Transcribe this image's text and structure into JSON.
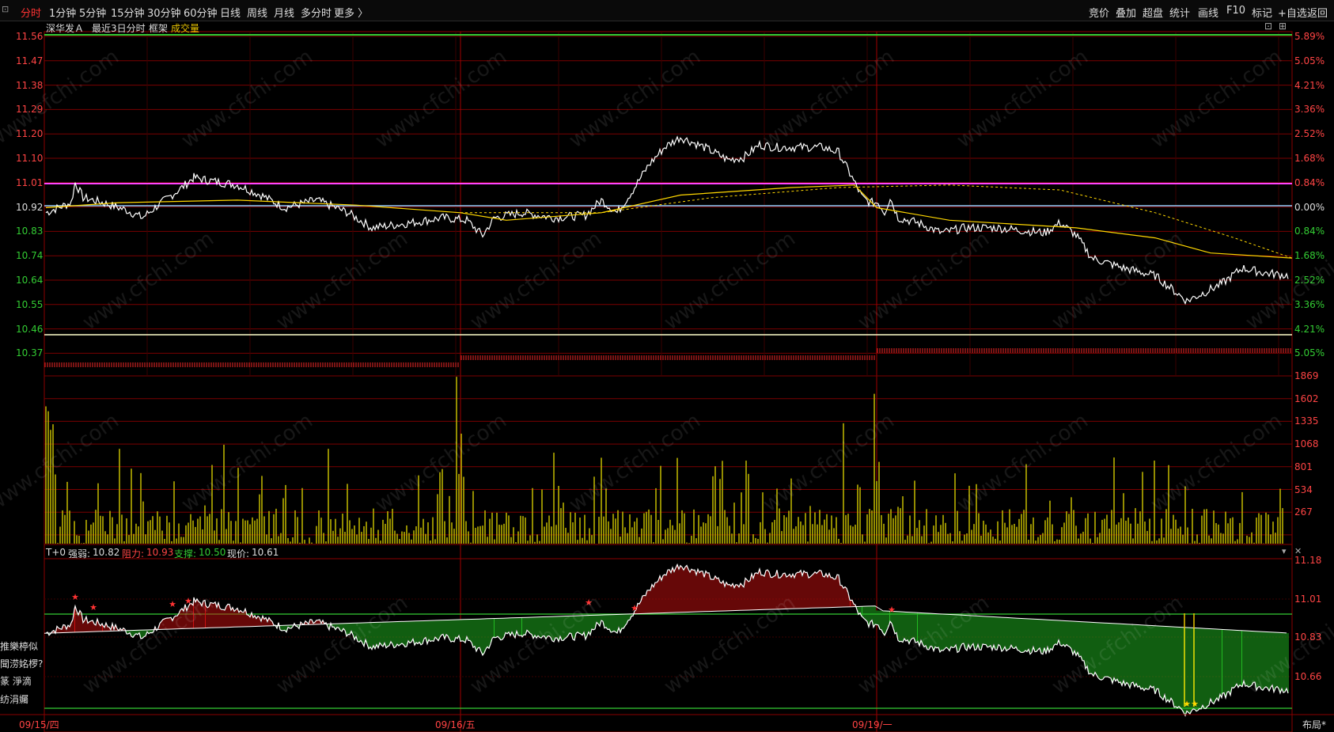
{
  "toolbar": {
    "left_tabs": [
      "分时",
      "1分钟",
      "5分钟",
      "15分钟",
      "30分钟",
      "60分钟",
      "日线",
      "周线",
      "月线",
      "多分时",
      "更多 〉"
    ],
    "active_tab": "分时",
    "right_buttons": [
      "竞价",
      "叠加",
      "超盘",
      "统计",
      "画线",
      "F10",
      "标记",
      "+自选",
      "返回"
    ]
  },
  "header": {
    "stock_name": "深华发Ａ",
    "period": "最近3日分时",
    "frame": "框架",
    "indicator": "成交量"
  },
  "price_axis": {
    "left_ticks": [
      "11.56",
      "11.47",
      "11.38",
      "11.29",
      "11.20",
      "11.10",
      "11.01",
      "10.92",
      "10.83",
      "10.74",
      "10.64",
      "10.55",
      "10.46",
      "10.37"
    ],
    "right_ticks": [
      "5.89%",
      "5.05%",
      "4.21%",
      "3.36%",
      "2.52%",
      "1.68%",
      "0.84%",
      "0.00%",
      "0.84%",
      "1.68%",
      "2.52%",
      "3.36%",
      "4.21%",
      "5.05%"
    ]
  },
  "volume_axis": {
    "right_ticks": [
      "1869",
      "1602",
      "1335",
      "1068",
      "801",
      "534",
      "267"
    ]
  },
  "t0_panel": {
    "title": "T+0",
    "strength_label": "强弱:",
    "strength_value": "10.82",
    "resistance_label": "阻力:",
    "resistance_value": "10.93",
    "support_label": "支撑:",
    "support_value": "10.50",
    "price_label": "现价:",
    "price_value": "10.61",
    "right_ticks": [
      "11.18",
      "11.01",
      "10.83",
      "10.66"
    ]
  },
  "left_side_labels": [
    "推樂楟似",
    "聞涝姳椤?",
    "篆 淨滴",
    "纺涓孎"
  ],
  "x_axis": {
    "dates": [
      "09/15/四",
      "09/16/五",
      "09/19/一"
    ],
    "layout_button": "布局*"
  },
  "colors": {
    "up": "#ff3333",
    "down": "#33cc33",
    "price_line": "#ffffff",
    "avg_line": "#ffd700",
    "volume_bar": "#b8b000",
    "grid": "#7a0000",
    "highlight": "#ff44ff"
  },
  "watermark": "www.cfchi.com"
}
